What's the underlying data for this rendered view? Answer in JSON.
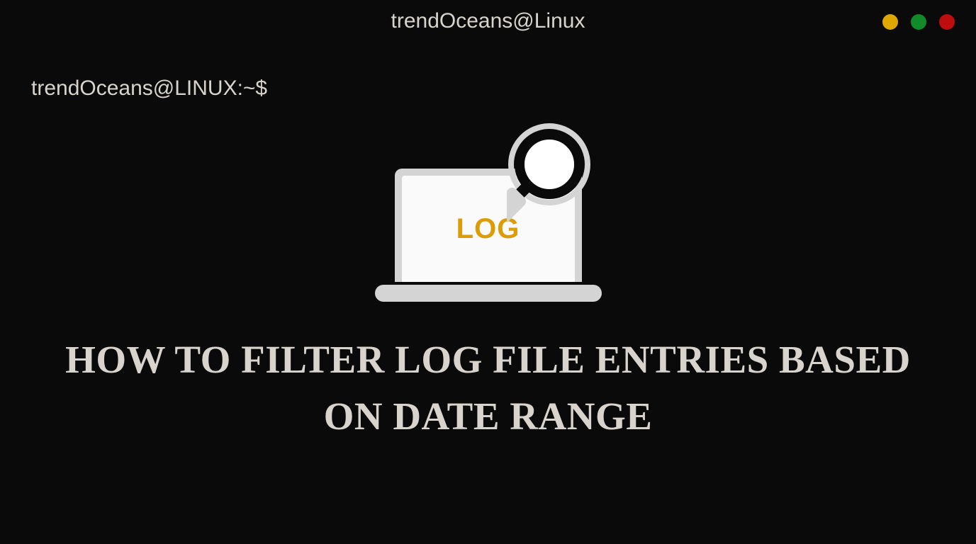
{
  "titleBar": {
    "title": "trendOceans@Linux"
  },
  "prompt": "trendOceans@LINUX:~$",
  "laptopScreenText": "LOG",
  "headline": "HOW TO FILTER LOG FILE ENTRIES BASED ON DATE RANGE",
  "trafficLights": {
    "minimize": "#dfa800",
    "maximize": "#118a29",
    "close": "#bd0d0d"
  }
}
